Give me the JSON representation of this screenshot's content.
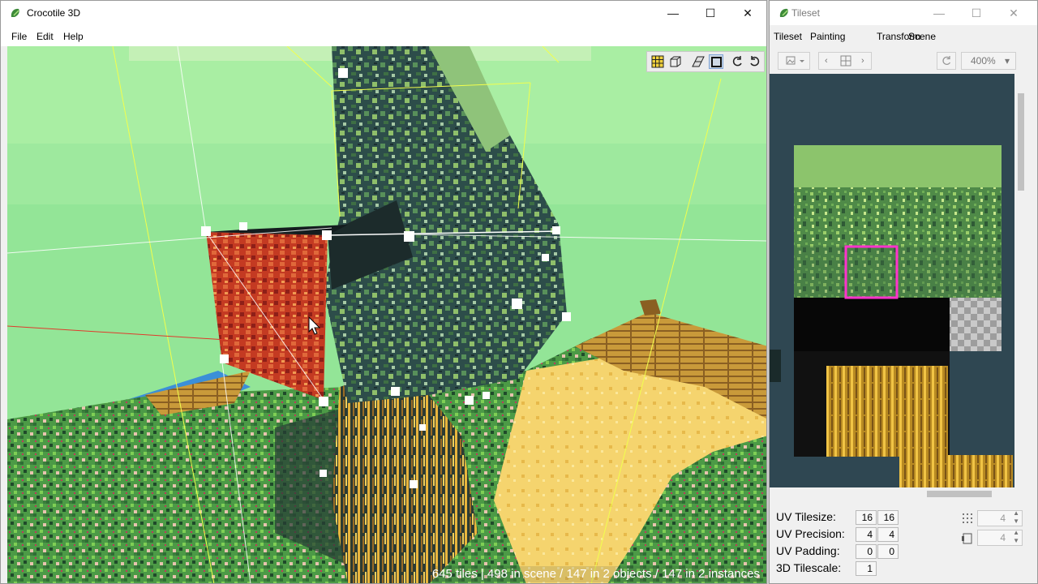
{
  "main_window": {
    "title": "Crocotile 3D",
    "caption": {
      "minimize": "—",
      "maximize": "☐",
      "close": "✕"
    },
    "menu": [
      "File",
      "Edit",
      "Help"
    ],
    "status": "645 tiles | 498 in scene / 147 in 2 objects / 147 in 2 instances",
    "viewport_tools": [
      {
        "name": "grid-tool-icon"
      },
      {
        "name": "box-select-tool-icon"
      },
      {
        "name": "tile-tool-icon"
      },
      {
        "name": "square-tool-icon",
        "active": true
      },
      {
        "name": "rotate-left-icon"
      },
      {
        "name": "rotate-right-icon"
      }
    ]
  },
  "tileset_window": {
    "title": "Tileset",
    "caption": {
      "minimize": "—",
      "maximize": "☐",
      "close": "✕"
    },
    "tabs": [
      "Tileset",
      "Painting",
      "Transform",
      "Scene"
    ],
    "zoom": "400%",
    "uv": {
      "tilesize_label": "UV Tilesize:",
      "tilesize": [
        "16",
        "16"
      ],
      "precision_label": "UV Precision:",
      "precision": [
        "4",
        "4"
      ],
      "padding_label": "UV Padding:",
      "padding": [
        "0",
        "0"
      ],
      "tilescale_label": "3D Tilescale:",
      "tilescale": "1",
      "spin_a": "4",
      "spin_b": "4"
    }
  },
  "colors": {
    "sky": "#93e597",
    "selection_pink": "#ff33cc",
    "canvas_bg": "#2f4752",
    "guide_yellow": "#f2ff4d"
  }
}
